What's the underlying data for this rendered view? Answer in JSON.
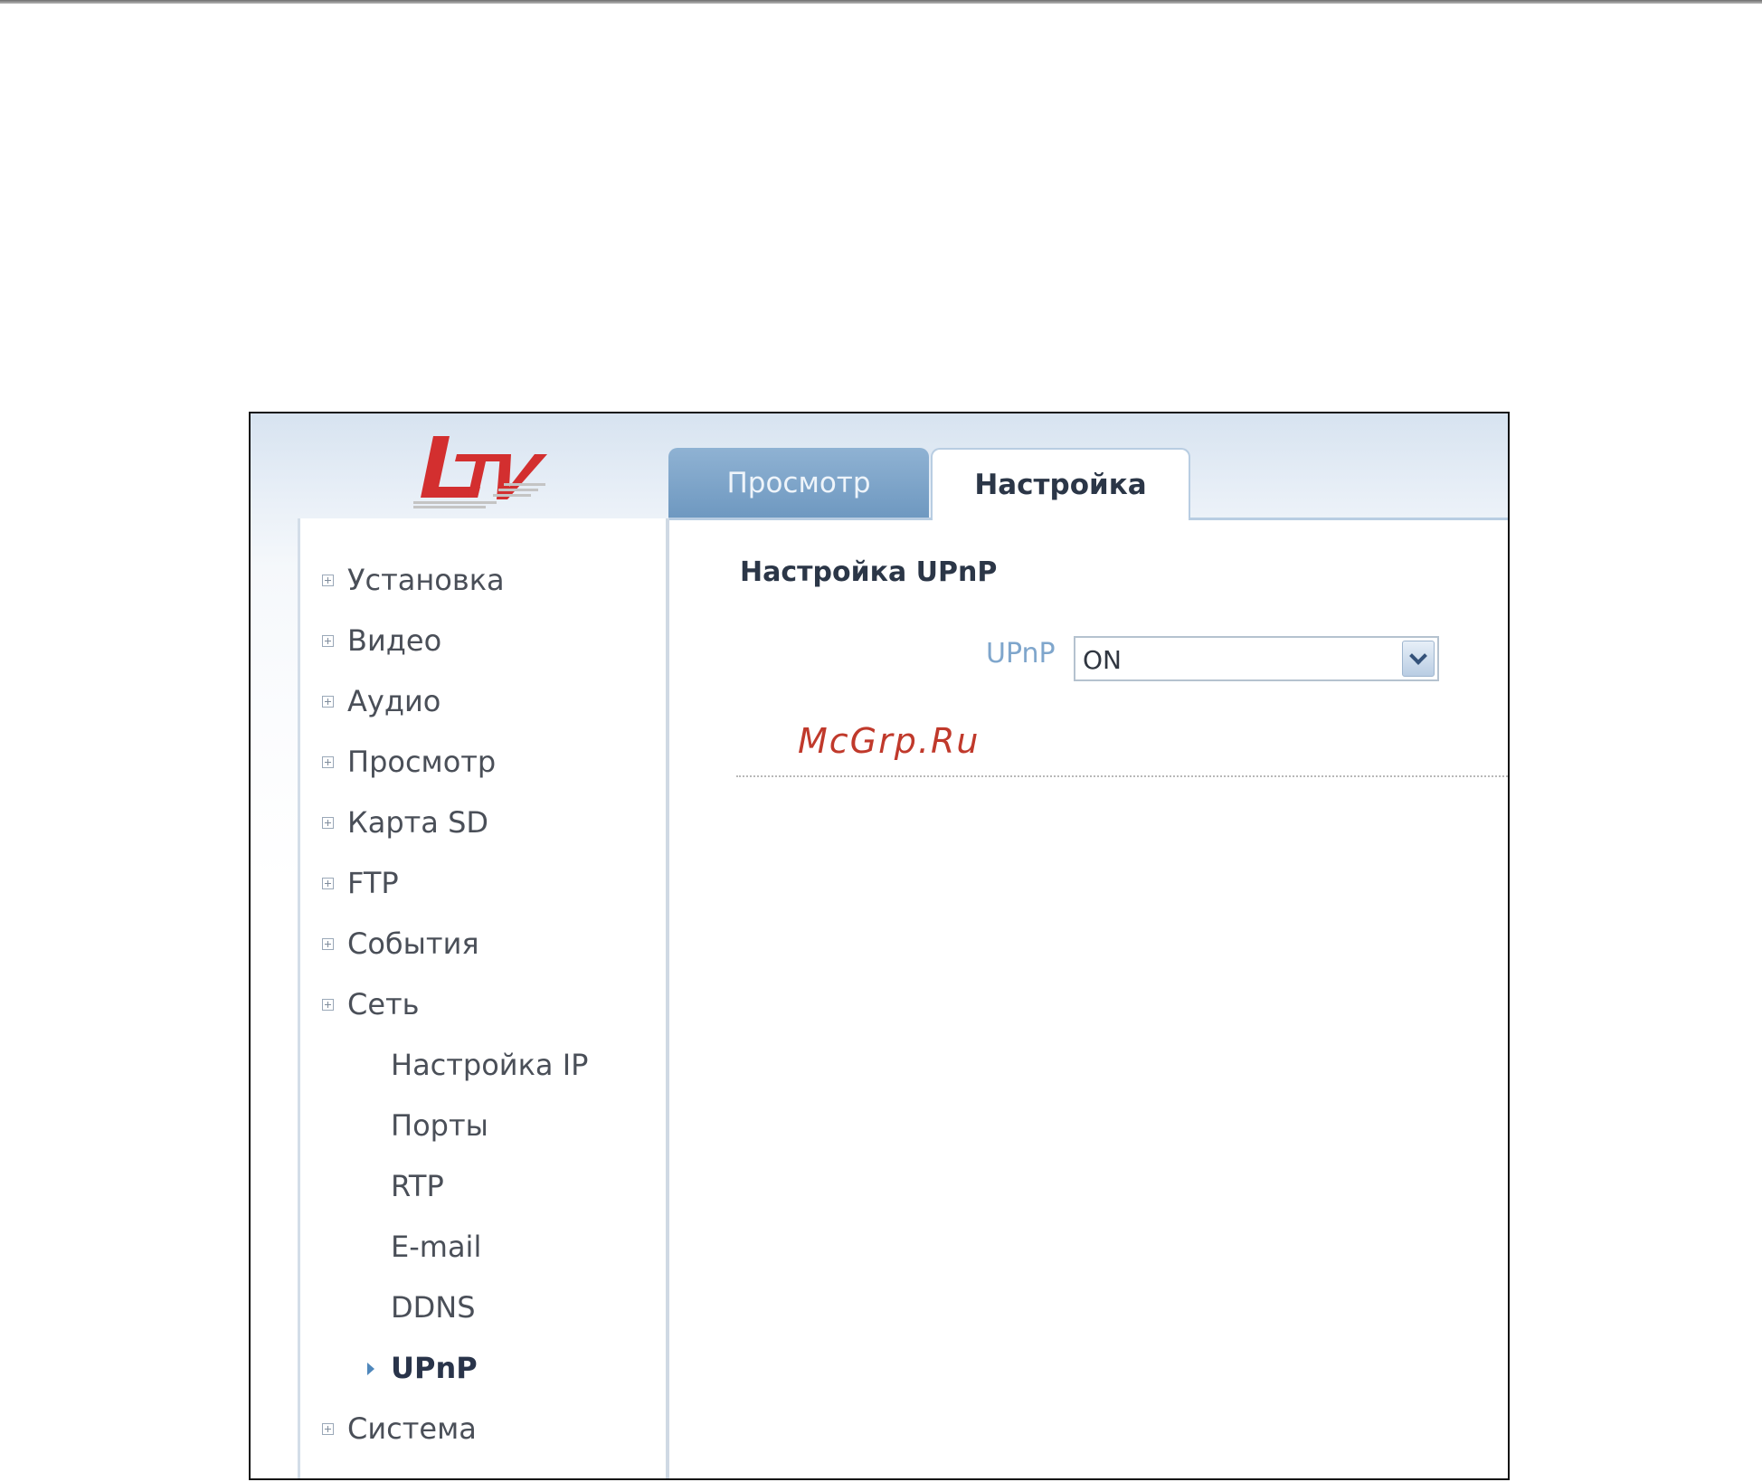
{
  "logo": {
    "text": "LTV",
    "brand_color": "#d32f2f"
  },
  "tabs": [
    {
      "label": "Просмотр",
      "active": false
    },
    {
      "label": "Настройка",
      "active": true
    }
  ],
  "sidebar": {
    "items": [
      {
        "label": "Установка",
        "icon": "plus-box-icon"
      },
      {
        "label": "Видео",
        "icon": "plus-box-icon"
      },
      {
        "label": "Аудио",
        "icon": "plus-box-icon"
      },
      {
        "label": "Просмотр",
        "icon": "plus-box-icon"
      },
      {
        "label": "Карта SD",
        "icon": "plus-box-icon"
      },
      {
        "label": "FTP",
        "icon": "plus-box-icon"
      },
      {
        "label": "События",
        "icon": "plus-box-icon"
      },
      {
        "label": "Сеть",
        "icon": "plus-box-icon",
        "expanded": true
      },
      {
        "label": "Система",
        "icon": "plus-box-icon"
      }
    ],
    "network_subitems": [
      {
        "label": "Настройка IP"
      },
      {
        "label": "Порты"
      },
      {
        "label": "RTP"
      },
      {
        "label": "E-mail"
      },
      {
        "label": "DDNS"
      },
      {
        "label": "UPnP",
        "active": true
      }
    ]
  },
  "main": {
    "section_title": "Настройка UPnP",
    "upnp": {
      "label": "UPnP",
      "value": "ON"
    }
  },
  "watermark": "McGrp.Ru",
  "colors": {
    "accent": "#7fa6cc",
    "tab_inactive": "#7ba2c8",
    "active_text": "#29344a"
  }
}
